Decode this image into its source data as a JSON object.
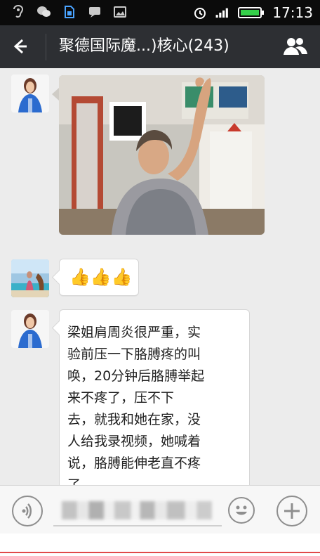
{
  "status_bar": {
    "time": "17:13",
    "icons": [
      "hearing-aid-icon",
      "wechat-icon",
      "sim-card-icon",
      "message-icon",
      "image-icon",
      "alarm-icon",
      "signal-icon",
      "battery-icon"
    ]
  },
  "header": {
    "title": "聚德国际魔...)核心(243)",
    "back_icon": "back-arrow-icon",
    "group_icon": "people-icon"
  },
  "messages": [
    {
      "type": "image",
      "sender_avatar": "avatar-woman-blue"
    },
    {
      "type": "emoji",
      "sender_avatar": "avatar-pool",
      "content": "👍👍👍"
    },
    {
      "type": "text",
      "sender_avatar": "avatar-woman-blue",
      "lines": [
        "梁姐肩周炎很严重，实",
        "验前压一下胳膊疼的叫",
        "唤，20分钟后胳膊举起",
        "来不疼了，压不下",
        "去，就我和她在家，没",
        "人给我录视频，她喊着",
        "说，胳膊能伸老直不疼",
        "了"
      ]
    }
  ],
  "input_bar": {
    "voice_icon": "voice-icon",
    "emoji_icon": "emoji-icon",
    "plus_icon": "plus-icon"
  },
  "colors": {
    "status_bar": "#0b0b0b",
    "title_bar": "#2d2f33",
    "chat_bg": "#ececec",
    "bubble_bg": "#ffffff",
    "accent_line": "#e14a4a"
  }
}
